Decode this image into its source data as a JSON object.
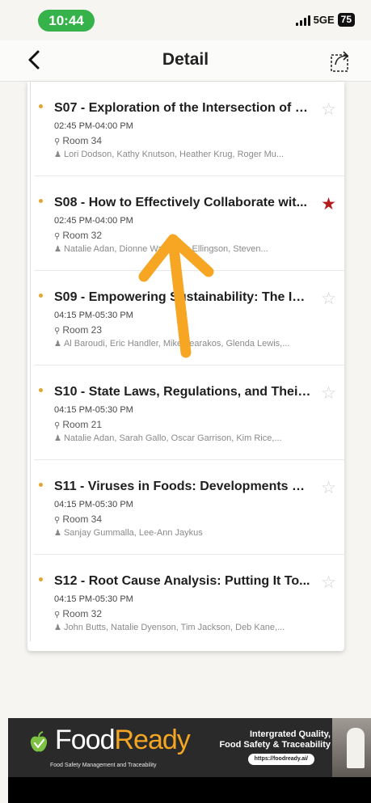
{
  "status_bar": {
    "time": "10:44",
    "network": "5GE",
    "battery": "75"
  },
  "header": {
    "title": "Detail"
  },
  "sessions": [
    {
      "title": "S07 - Exploration of the Intersection of C...",
      "time": "02:45 PM-04:00 PM",
      "room": "Room 34",
      "speakers": "Lori Dodson, Kathy Knutson, Heather Krug, Roger Mu...",
      "starred": false
    },
    {
      "title": "S08 - How to Effectively Collaborate wit...",
      "time": "02:45 PM-04:00 PM",
      "room": "Room 32",
      "speakers": "Natalie Adan, Dionne Ward, Jay Ellingson, Steven...",
      "starred": true
    },
    {
      "title": "S09 - Empowering Sustainability: The Im...",
      "time": "04:15 PM-05:30 PM",
      "room": "Room 23",
      "speakers": "Al Baroudi, Eric Handler, Mike Learakos, Glenda Lewis,...",
      "starred": false
    },
    {
      "title": "S10 - State Laws, Regulations, and Their...",
      "time": "04:15 PM-05:30 PM",
      "room": "Room 21",
      "speakers": "Natalie Adan, Sarah Gallo, Oscar Garrison, Kim Rice,...",
      "starred": false
    },
    {
      "title": "S11 - Viruses in Foods: Developments Ov...",
      "time": "04:15 PM-05:30 PM",
      "room": "Room 34",
      "speakers": "Sanjay Gummalla, Lee-Ann Jaykus",
      "starred": false
    },
    {
      "title": "S12 - Root Cause Analysis: Putting It To...",
      "time": "04:15 PM-05:30 PM",
      "room": "Room 32",
      "speakers": "John Butts, Natalie Dyenson, Tim Jackson, Deb Kane,...",
      "starred": false
    }
  ],
  "ad": {
    "brand_food": "Food",
    "brand_ready": "Ready",
    "tagline": "Food Safety Management and Traceability",
    "headline_1": "Intergrated Quality,",
    "headline_2": "Food Safety & Traceability",
    "url": "https://foodready.ai/"
  },
  "colors": {
    "accent_dot": "#e3a532",
    "star_on": "#b51c1c",
    "star_off": "#d0d0d0",
    "time_pill": "#36b24a",
    "arrow": "#f6a623"
  },
  "icons": {
    "back": "chevron-left-icon",
    "share": "share-icon",
    "star": "star-icon",
    "location": "pin-icon",
    "person": "person-icon"
  }
}
